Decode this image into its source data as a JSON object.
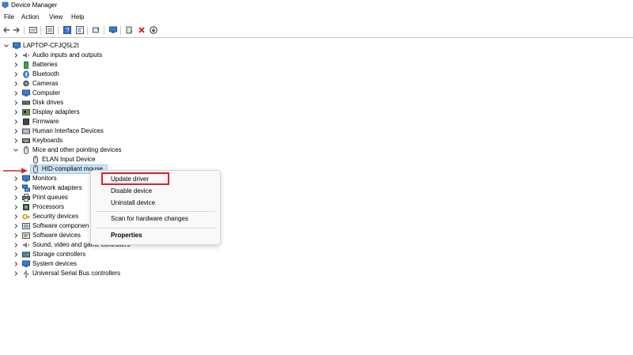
{
  "window": {
    "title": "Device Manager"
  },
  "menu": [
    "File",
    "Action",
    "View",
    "Help"
  ],
  "toolbar_icons": [
    "back-icon",
    "forward-icon",
    "properties-view-icon",
    "help-icon",
    "show-hidden-icon",
    "refresh-icon",
    "monitor-icon",
    "update-driver-icon",
    "uninstall-icon",
    "download-icon"
  ],
  "tree": {
    "root": "LAPTOP-CFJQ5L2I",
    "categories": [
      "Audio inputs and outputs",
      "Batteries",
      "Bluetooth",
      "Cameras",
      "Computer",
      "Disk drives",
      "Display adapters",
      "Firmware",
      "Human Interface Devices",
      "Keyboards",
      "Mice and other pointing devices",
      "ELAN Input Device",
      "HID-compliant mouse",
      "Monitors",
      "Network adapters",
      "Print queues",
      "Processors",
      "Security devices",
      "Software componen",
      "Software devices",
      "Sound, video and game controllers",
      "Storage controllers",
      "System devices",
      "Universal Serial Bus controllers"
    ]
  },
  "context_menu": {
    "update": "Update driver",
    "disable": "Disable device",
    "uninstall": "Uninstall device",
    "scan": "Scan for hardware changes",
    "properties": "Properties"
  },
  "colors": {
    "highlight": "#d4252b",
    "selection": "#cce4f7"
  }
}
